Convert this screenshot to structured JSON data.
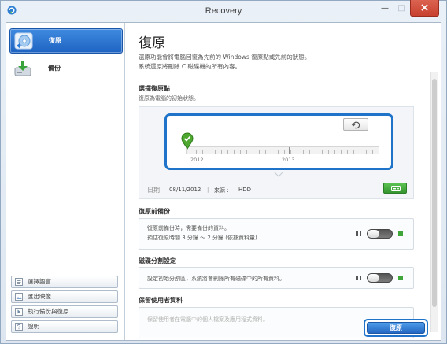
{
  "window": {
    "title": "Recovery",
    "minimize_glyph": "—",
    "maximize_glyph": "□",
    "close_glyph": "×",
    "app_icon": "recovery-app-icon"
  },
  "sidebar": {
    "items": [
      {
        "label": "復原",
        "icon": "restore-disc-icon",
        "selected": true
      },
      {
        "label": "備份",
        "icon": "backup-drive-icon",
        "selected": false
      }
    ],
    "bottom_buttons": [
      {
        "label": "選擇語言",
        "icon": "language-icon"
      },
      {
        "label": "匯出映像",
        "icon": "export-image-icon"
      },
      {
        "label": "執行備份與復原",
        "icon": "run-icon"
      },
      {
        "label": "說明",
        "icon": "help-icon"
      }
    ]
  },
  "main": {
    "title": "復原",
    "description": [
      "還原功能會將電腦回復為先前的 Windows 復原點或先前的狀態。",
      "系統還原將刪除 C 磁碟機的所有內容。"
    ],
    "restore_point": {
      "heading": "選擇復原點",
      "subtitle": "復原為電腦的初始狀態。",
      "timeline_labels": [
        "2012",
        "2013"
      ],
      "date_label": "日期",
      "date_value": "08/11/2012",
      "divider": "|",
      "source_label": "來源 :",
      "source_value": "HDD",
      "refresh_icon": "refresh-icon",
      "source_icon": "drive-icon"
    },
    "options": [
      {
        "heading": "復原前備份",
        "lines": [
          "復原前備份時，需要備份的資料。",
          "預估復原時間 3 分鐘 ～ 2 分鐘 (依據資料量)"
        ],
        "enabled": false
      },
      {
        "heading": "磁碟分割設定",
        "lines": [
          "設定初始分割區，系統將會刪除所有磁碟中的所有資料。"
        ],
        "enabled": false
      },
      {
        "heading": "保留使用者資料",
        "lines": [
          "保留使用者在電腦中的個人檔案及應用程式資料。"
        ]
      }
    ],
    "restore_button": "復原"
  },
  "colors": {
    "accent": "#1f74c9",
    "toggle_on": "#3fa63a",
    "close_button": "#c8412f"
  }
}
